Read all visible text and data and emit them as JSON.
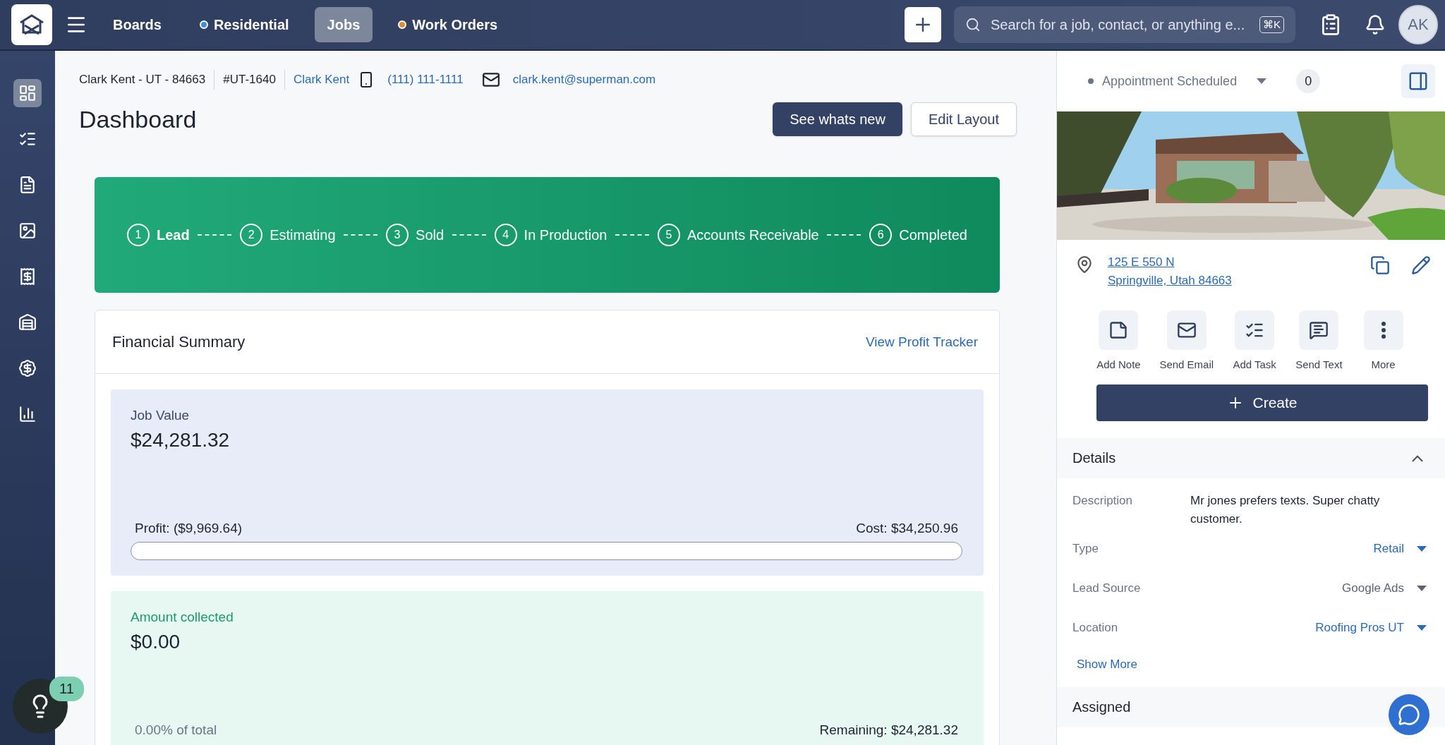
{
  "top_nav": {
    "items": [
      {
        "label": "Boards",
        "selected": false
      },
      {
        "label": "Residential",
        "selected": false,
        "color": "#3b8fe0"
      },
      {
        "label": "Jobs",
        "selected": true
      },
      {
        "label": "Work Orders",
        "selected": false,
        "color": "#e58a2e"
      }
    ],
    "search": {
      "placeholder": "Search for a job, contact, or anything e...",
      "shortcut": "⌘K"
    },
    "avatar": "AK"
  },
  "sidebar": {
    "items": [
      {
        "selected": true
      },
      {
        "selected": false
      },
      {
        "selected": false
      },
      {
        "selected": false
      },
      {
        "selected": false
      },
      {
        "selected": false
      },
      {
        "selected": false
      },
      {
        "selected": false
      }
    ]
  },
  "job_header": {
    "name": "Clark Kent - UT - 84663",
    "number": "#UT-1640",
    "contact": "Clark Kent",
    "phone": "(111) 111-1111",
    "email": "clark.kent@superman.com"
  },
  "page_title": "Dashboard",
  "buttons": [
    {
      "label": "See whats new",
      "kind": "primary"
    },
    {
      "label": "Edit Layout",
      "kind": "secondary"
    }
  ],
  "stages": [
    {
      "number": "1",
      "label": "Lead",
      "current": true
    },
    {
      "number": "2",
      "label": "Estimating",
      "current": false
    },
    {
      "number": "3",
      "label": "Sold",
      "current": false
    },
    {
      "number": "4",
      "label": "In Production",
      "current": false
    },
    {
      "number": "5",
      "label": "Accounts Receivable",
      "current": false
    },
    {
      "number": "6",
      "label": "Completed",
      "current": false
    }
  ],
  "financial_summary": {
    "title": "Financial Summary",
    "link": "View Profit Tracker",
    "job_value": {
      "label": "Job Value",
      "amount": "$24,281.32",
      "left": "Profit: ($9,969.64)",
      "right": "Cost: $34,250.96"
    },
    "amount_collected": {
      "label": "Amount collected",
      "amount": "$0.00",
      "left": "0.00% of total",
      "right": "Remaining: $24,281.32"
    }
  },
  "help_badge": "11",
  "side_panel": {
    "status": "Appointment Scheduled",
    "count": "0",
    "address": [
      "125 E 550 N",
      "Springville, Utah 84663"
    ],
    "actions": [
      "Add Note",
      "Send Email",
      "Add Task",
      "Send Text",
      "More"
    ],
    "create": "Create",
    "details": {
      "title": "Details",
      "expanded": true,
      "fields": [
        {
          "label": "Description",
          "value": "Mr jones prefers texts. Super chatty customer.",
          "kind": "text"
        },
        {
          "label": "Type",
          "value": "Retail",
          "kind": "select",
          "color": "#2a6bb8"
        },
        {
          "label": "Lead Source",
          "value": "Google Ads",
          "kind": "select",
          "color": "#5b6470"
        },
        {
          "label": "Location",
          "value": "Roofing Pros UT",
          "kind": "select",
          "color": "#2a6bb8"
        }
      ],
      "show_more": "Show More"
    },
    "assigned": {
      "title": "Assigned"
    }
  }
}
